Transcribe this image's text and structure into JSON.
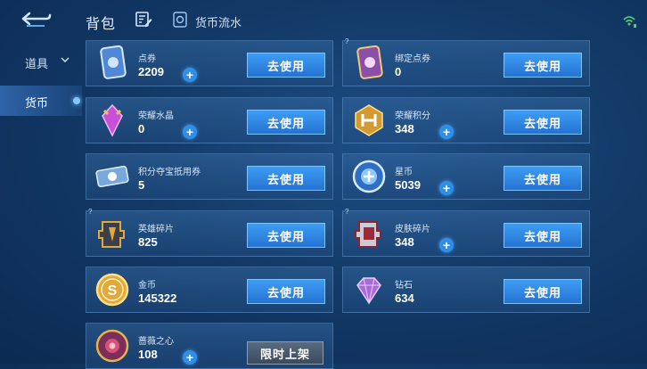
{
  "header": {
    "title": "背包",
    "flow_label": "货币流水"
  },
  "sidebar": {
    "items": [
      {
        "label": "道具"
      },
      {
        "label": "货币"
      }
    ]
  },
  "currencies": [
    {
      "name": "点券",
      "amount": "2209",
      "action": "去使用"
    },
    {
      "name": "绑定点券",
      "amount": "0",
      "action": "去使用"
    },
    {
      "name": "荣耀水晶",
      "amount": "0",
      "action": "去使用"
    },
    {
      "name": "荣耀积分",
      "amount": "348",
      "action": "去使用"
    },
    {
      "name": "积分夺宝抵用券",
      "amount": "5",
      "action": "去使用"
    },
    {
      "name": "星币",
      "amount": "5039",
      "action": "去使用"
    },
    {
      "name": "英雄碎片",
      "amount": "825",
      "action": "去使用"
    },
    {
      "name": "皮肤碎片",
      "amount": "348",
      "action": "去使用"
    },
    {
      "name": "金币",
      "amount": "145322",
      "action": "去使用"
    },
    {
      "name": "钻石",
      "amount": "634",
      "action": "去使用"
    },
    {
      "name": "蔷薇之心",
      "amount": "108",
      "action": "限时上架"
    }
  ],
  "colors": {
    "accent_blue": "#2f8fe8",
    "button_blue": "#2473d3",
    "gold": "#e0a93a",
    "purple": "#a86ad8"
  }
}
